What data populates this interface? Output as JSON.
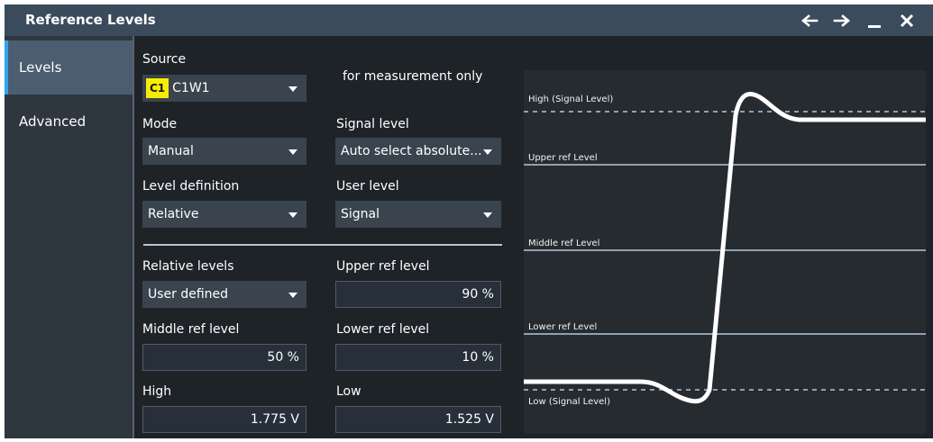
{
  "window": {
    "title": "Reference Levels",
    "controls": [
      "back-arrow-icon",
      "forward-arrow-icon",
      "minimize-icon",
      "close-icon"
    ]
  },
  "sidebar": {
    "tabs": [
      {
        "label": "Levels",
        "active": true
      },
      {
        "label": "Advanced",
        "active": false
      }
    ]
  },
  "form": {
    "source": {
      "label": "Source",
      "badge": "C1",
      "value": "C1W1"
    },
    "note": "for measurement only",
    "mode": {
      "label": "Mode",
      "value": "Manual"
    },
    "signal_level": {
      "label": "Signal level",
      "value": "Auto select absolute..."
    },
    "level_definition": {
      "label": "Level definition",
      "value": "Relative"
    },
    "user_level": {
      "label": "User level",
      "value": "Signal"
    },
    "relative_levels": {
      "label": "Relative levels",
      "value": "User defined"
    },
    "upper_ref": {
      "label": "Upper ref level",
      "value": "90 %"
    },
    "middle_ref": {
      "label": "Middle ref level",
      "value": "50 %"
    },
    "lower_ref": {
      "label": "Lower ref level",
      "value": "10 %"
    },
    "high": {
      "label": "High",
      "value": "1.775 V"
    },
    "low": {
      "label": "Low",
      "value": "1.525 V"
    }
  },
  "diagram": {
    "high_signal": "High (Signal Level)",
    "upper_ref": "Upper ref Level",
    "middle_ref": "Middle ref Level",
    "lower_ref": "Lower ref Level",
    "low_signal": "Low (Signal Level)"
  },
  "colors": {
    "titlebar": "#3b4b5c",
    "active_tab_indicator": "#2fa6ee",
    "source_badge": "#f5ee00",
    "waveform": "#ffffff",
    "ref_lines": "#8fa0b0"
  }
}
